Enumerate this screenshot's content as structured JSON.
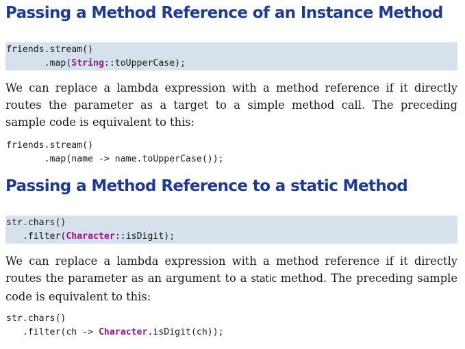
{
  "section1": {
    "heading": "Passing a Method Reference of an Instance Method",
    "code1": {
      "l1": "friends.stream()",
      "l2_pre": "       .map(",
      "l2_kw": "String",
      "l2_post": "::toUpperCase);"
    },
    "para": {
      "l1": "We can replace a lambda expression with a method reference if it directly",
      "l2": "routes the parameter as a target to a simple method call. The preceding",
      "l3": "sample code is equivalent to this:"
    },
    "code2": {
      "l1": "friends.stream()",
      "l2": "       .map(name -> name.toUpperCase());"
    }
  },
  "section2": {
    "heading": "Passing a Method Reference to a static Method",
    "code1": {
      "l1": "str.chars()",
      "l2_pre": "   .filter(",
      "l2_kw": "Character",
      "l2_post": "::isDigit);"
    },
    "para": {
      "l1": "We can replace a lambda expression with a method reference if it directly",
      "l2_pre": "routes the parameter as an argument to a ",
      "l2_kw": "static",
      "l2_post": " method. The preceding sample",
      "l3": "code is equivalent to this:"
    },
    "code2": {
      "l1": "str.chars()",
      "l2_pre": "   .filter(ch -> ",
      "l2_kw": "Character",
      "l2_post": ".isDigit(ch));"
    }
  },
  "colors": {
    "heading": "#1f3a8f",
    "code_background": "#d6e1ec",
    "keyword": "#8c1a86"
  }
}
